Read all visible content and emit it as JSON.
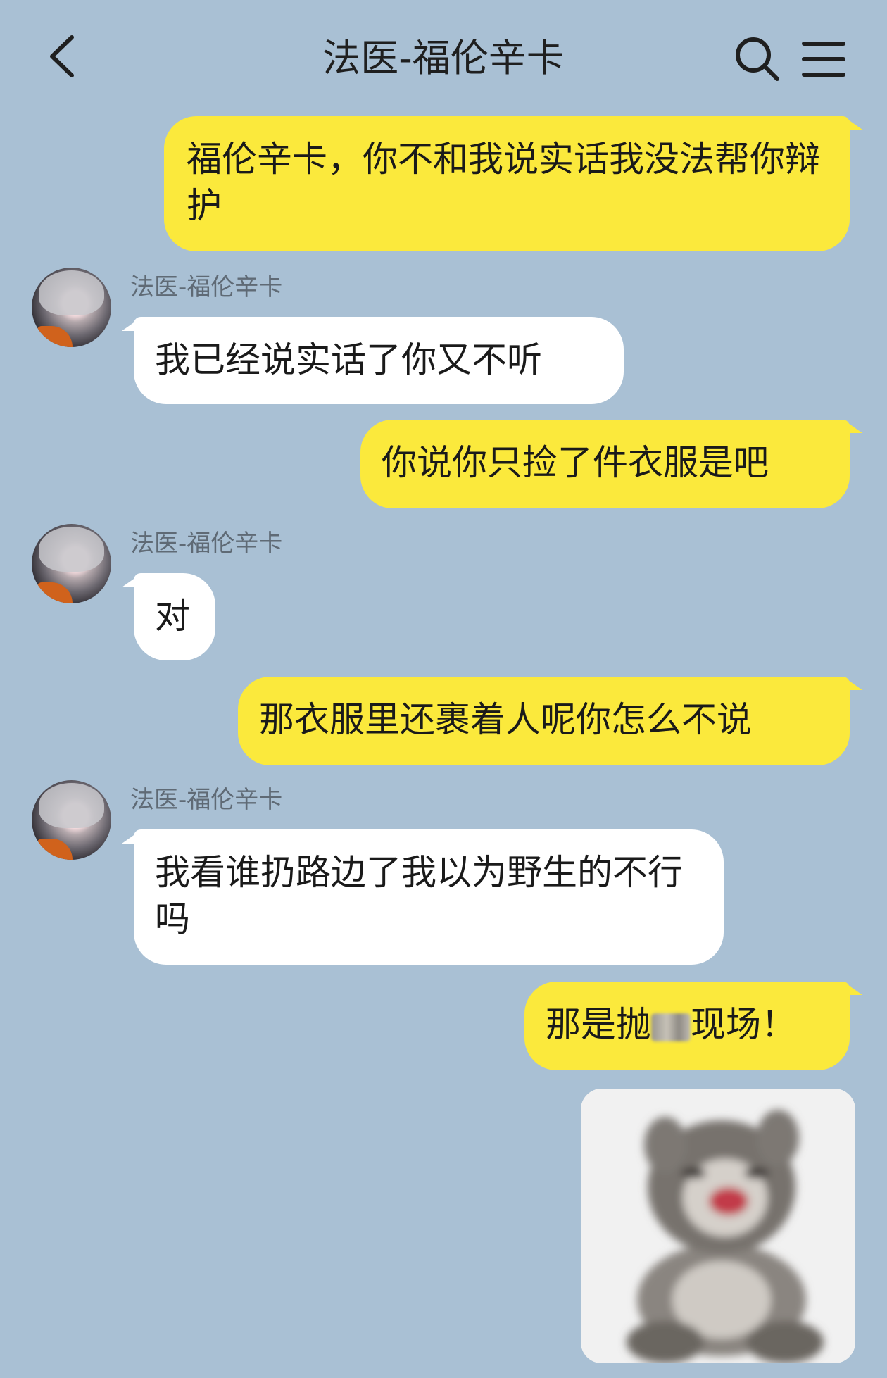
{
  "header": {
    "title": "法医-福伦辛卡",
    "back_icon": "chevron-left-icon",
    "search_icon": "search-icon",
    "menu_icon": "menu-icon"
  },
  "colors": {
    "background": "#a9c0d4",
    "outgoing_bubble": "#fbe93c",
    "incoming_bubble": "#ffffff"
  },
  "messages": [
    {
      "direction": "out",
      "text": "福伦辛卡，你不和我说实话我没法帮你辩护"
    },
    {
      "direction": "in",
      "sender": "法医-福伦辛卡",
      "text": "我已经说实话了你又不听"
    },
    {
      "direction": "out",
      "text": "你说你只捡了件衣服是吧"
    },
    {
      "direction": "in",
      "sender": "法医-福伦辛卡",
      "text": "对"
    },
    {
      "direction": "out",
      "text": "那衣服里还裹着人呢你怎么不说"
    },
    {
      "direction": "in",
      "sender": "法医-福伦辛卡",
      "text": "我看谁扔路边了我以为野生的不行吗"
    },
    {
      "direction": "out",
      "text_before": "那是抛",
      "text_after": "现场！"
    },
    {
      "direction": "out",
      "type": "sticker",
      "sticker": "crying-cat-sticker"
    }
  ]
}
